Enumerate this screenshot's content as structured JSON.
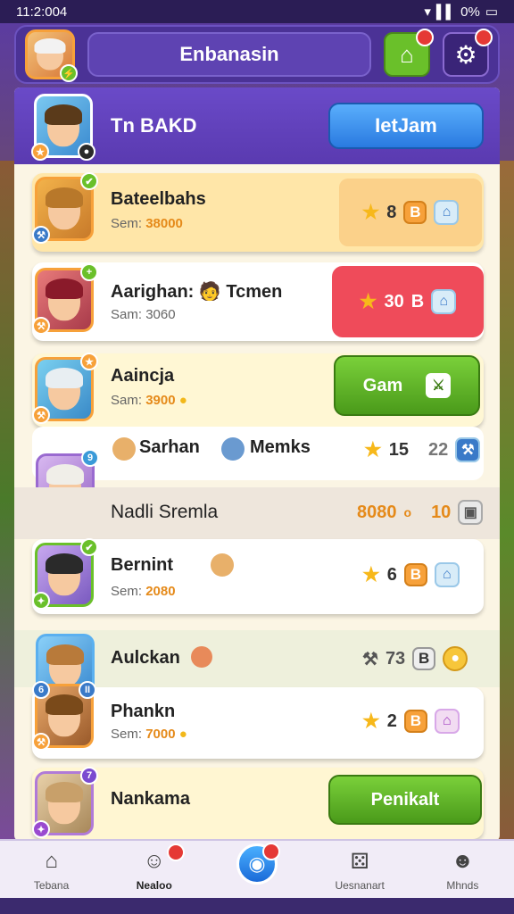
{
  "status_bar": {
    "time": "11:2:004",
    "battery": "0%"
  },
  "header": {
    "title": "Enbanasin",
    "home_badge": "",
    "settings_badge": ""
  },
  "hero": {
    "name": "Tn BAKD",
    "button_label": "IetJam"
  },
  "rows": [
    {
      "name": "Bateelbahs",
      "score_label": "Sem:",
      "score_value": "38000",
      "stars": "8",
      "badge": "B",
      "color": "#ffe6a8"
    },
    {
      "name": "Aarighan: 🧑 Tcmen",
      "score_label": "Sam:",
      "score_value": "3060",
      "stars": "30",
      "badge": "B",
      "color": "#ffffff"
    },
    {
      "name": "Aaincja",
      "score_label": "Sam:",
      "score_value": "3900",
      "button_label": "Gam",
      "color": "#fff7d4"
    },
    {
      "name": "Sarhan",
      "name2": "Memks",
      "stars": "15",
      "extra": "22",
      "color": "#ffffff"
    },
    {
      "name": "Nadli Sremla",
      "score_value": "8080",
      "extra": "10",
      "color": "#eee6dc"
    },
    {
      "name": "Bernint",
      "score_label": "Sem:",
      "score_value": "2080",
      "stars": "6",
      "badge": "B",
      "color": "#ffffff"
    },
    {
      "name": "Aulckan",
      "extra": "73",
      "badge": "B",
      "color": "#eef0dc"
    },
    {
      "name": "Phankn",
      "score_label": "Sem:",
      "score_value": "7000",
      "stars": "2",
      "badge": "B",
      "color": "#ffffff"
    },
    {
      "name": "Nankama",
      "button_label": "Penikalt",
      "color": "#fff6d2"
    }
  ],
  "tabs": [
    {
      "label": "Tebana",
      "icon": "home-icon"
    },
    {
      "label": "Nealoo",
      "icon": "chat-icon"
    },
    {
      "label": "",
      "icon": "map-pin-icon"
    },
    {
      "label": "Uesnanart",
      "icon": "dice-icon"
    },
    {
      "label": "Mhnds",
      "icon": "profile-icon"
    }
  ],
  "colors": {
    "accent_purple": "#5e43b2",
    "gold": "#f7a13a",
    "green": "#6ac02a",
    "red": "#ef4b5a",
    "blue": "#2a7ae0"
  }
}
